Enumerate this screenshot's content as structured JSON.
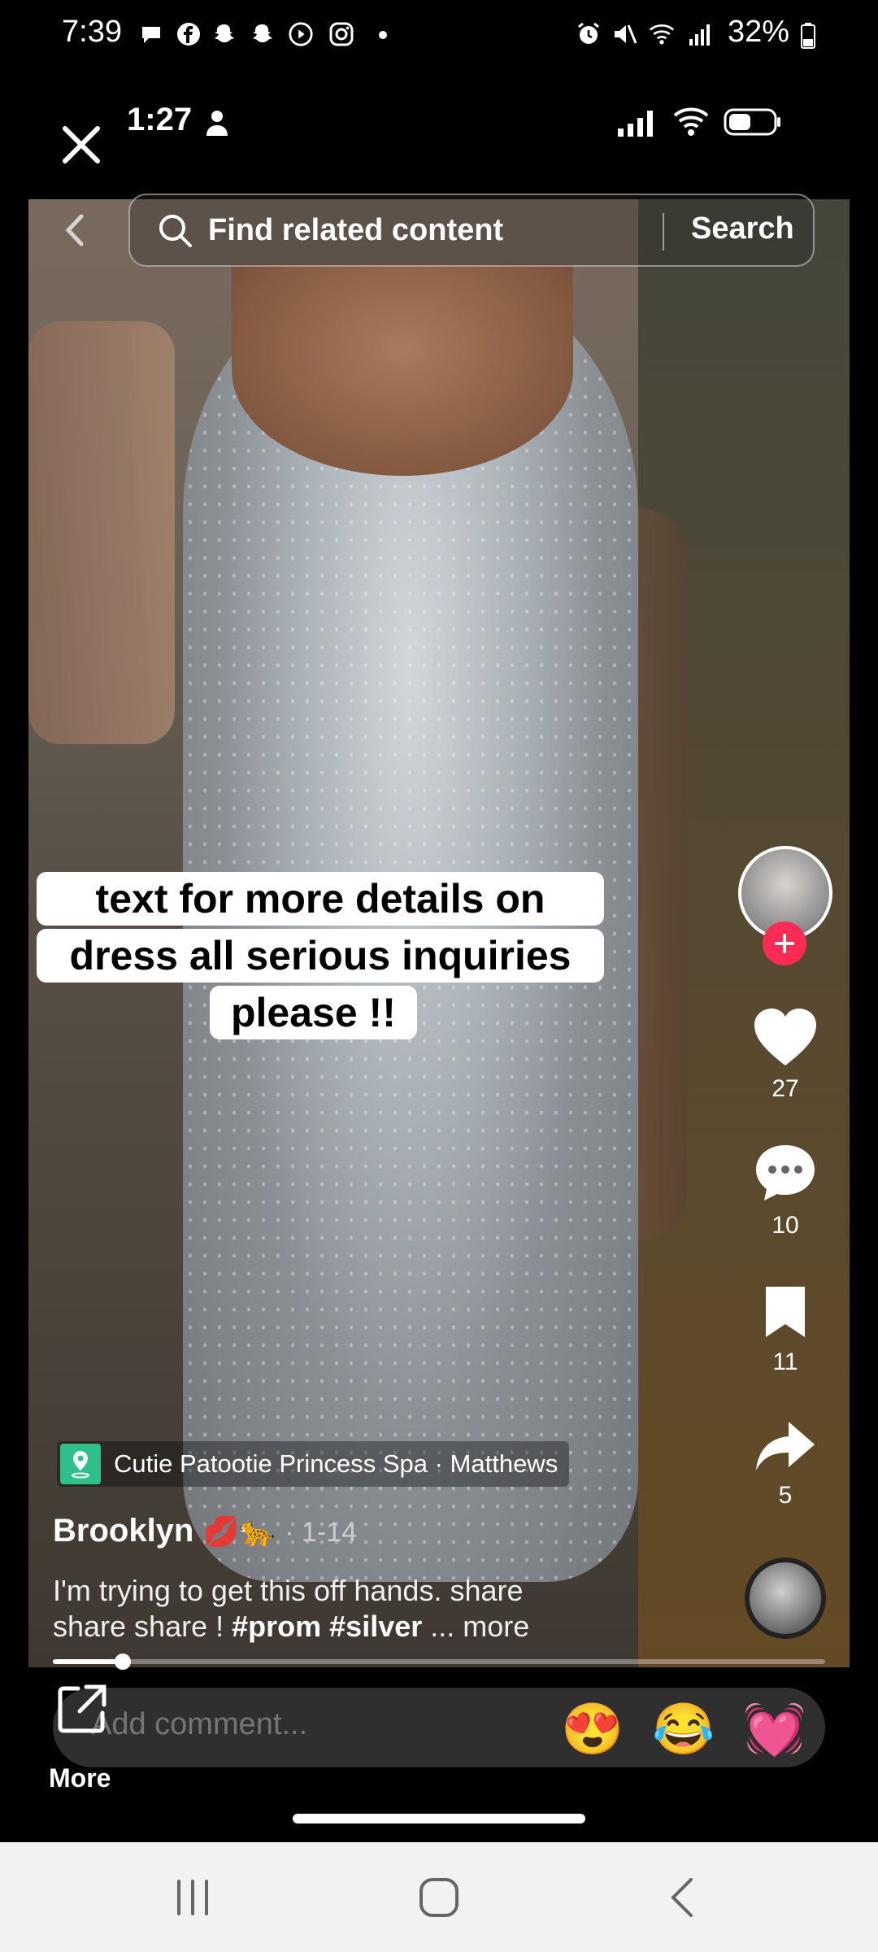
{
  "status_bar": {
    "time": "7:39",
    "battery": "32%"
  },
  "inner_header": {
    "time": "1:27"
  },
  "search": {
    "placeholder": "Find related content",
    "button_label": "Search"
  },
  "caption": {
    "line1": "text for more details on",
    "line2": "dress all serious inquiries",
    "line3": "please !!"
  },
  "rail": {
    "likes": "27",
    "comments": "10",
    "saves": "11",
    "shares": "5"
  },
  "post": {
    "location": "Cutie Patootie Princess Spa · Matthews",
    "username": "Brooklyn",
    "username_emojis": "💋🐆",
    "date": "· 1-14",
    "description_line1": "I'm trying to get this off hands. share",
    "description_line2": "share share ! ",
    "hashtags": "#prom #silver",
    "more": "... more",
    "progress": 0.09
  },
  "comment": {
    "placeholder": "Add comment...",
    "emojis": [
      "😍",
      "😂",
      "💓"
    ]
  },
  "more_label": "More",
  "colors": {
    "accent_red": "#fe2c55",
    "nav_bg": "#f2f2f2"
  }
}
